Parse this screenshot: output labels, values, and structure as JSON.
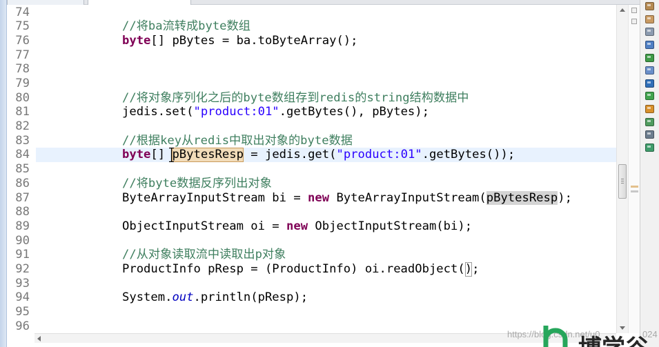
{
  "editor": {
    "lines": [
      {
        "n": "74",
        "tokens": []
      },
      {
        "n": "75",
        "tokens": [
          {
            "t": "//将ba流转成byte数组",
            "fg": "#3F7F5F"
          }
        ]
      },
      {
        "n": "76",
        "tokens": [
          {
            "t": "byte",
            "fg": "#7F0055",
            "b": true
          },
          {
            "t": "[] pBytes = ba.toByteArray();"
          }
        ]
      },
      {
        "n": "77",
        "tokens": []
      },
      {
        "n": "78",
        "tokens": []
      },
      {
        "n": "79",
        "tokens": []
      },
      {
        "n": "80",
        "tokens": [
          {
            "t": "//将对象序列化之后的byte数组存到redis的string结构数据中",
            "fg": "#3F7F5F"
          }
        ]
      },
      {
        "n": "81",
        "tokens": [
          {
            "t": "jedis.set("
          },
          {
            "t": "\"product:01\"",
            "fg": "#2A00FF"
          },
          {
            "t": ".getBytes(), pBytes);"
          }
        ]
      },
      {
        "n": "82",
        "tokens": []
      },
      {
        "n": "83",
        "tokens": [
          {
            "t": "//根据key从redis中取出对象的byte数据",
            "fg": "#3F7F5F"
          }
        ]
      },
      {
        "n": "84",
        "current": true,
        "tokens": [
          {
            "t": "byte",
            "fg": "#7F0055",
            "b": true
          },
          {
            "t": "[] "
          },
          {
            "t": "pBytesResp",
            "bg": "#F2DCB9",
            "bd": "#C99A5B"
          },
          {
            "t": " = jedis.get("
          },
          {
            "t": "\"product:01\"",
            "fg": "#2A00FF"
          },
          {
            "t": ".getBytes());"
          }
        ]
      },
      {
        "n": "85",
        "tokens": []
      },
      {
        "n": "86",
        "tokens": [
          {
            "t": "//将byte数据反序列出对象",
            "fg": "#3F7F5F"
          }
        ]
      },
      {
        "n": "87",
        "tokens": [
          {
            "t": "ByteArrayInputStream bi = "
          },
          {
            "t": "new",
            "fg": "#7F0055",
            "b": true
          },
          {
            "t": " ByteArrayInputStream("
          },
          {
            "t": "pBytesResp",
            "bg": "#D4D4D4"
          },
          {
            "t": ");"
          }
        ]
      },
      {
        "n": "88",
        "tokens": []
      },
      {
        "n": "89",
        "tokens": [
          {
            "t": "ObjectInputStream oi = "
          },
          {
            "t": "new",
            "fg": "#7F0055",
            "b": true
          },
          {
            "t": " ObjectInputStream(bi);"
          }
        ]
      },
      {
        "n": "90",
        "tokens": []
      },
      {
        "n": "91",
        "tokens": [
          {
            "t": "//从对象读取流中读取出p对象",
            "fg": "#3F7F5F"
          }
        ]
      },
      {
        "n": "92",
        "tokens": [
          {
            "t": "ProductInfo pResp = (ProductInfo) oi.readObject("
          },
          {
            "t": ")",
            "bd": "#9B9B9B"
          },
          {
            "t": ";"
          }
        ]
      },
      {
        "n": "93",
        "tokens": []
      },
      {
        "n": "94",
        "tokens": [
          {
            "t": "System."
          },
          {
            "t": "out",
            "fg": "#0000C0",
            "i": true
          },
          {
            "t": ".println(pResp);"
          }
        ]
      },
      {
        "n": "95",
        "tokens": []
      },
      {
        "n": "96",
        "tokens": []
      }
    ]
  },
  "colors": {
    "current_line": "#E8F2FE",
    "line_number": "#787878",
    "default_text": "#000000"
  },
  "side_toolbar": {
    "icons": [
      {
        "name": "package-explorer-icon",
        "color": "#B58A52"
      },
      {
        "name": "navigator-icon",
        "color": "#C99A62"
      },
      {
        "name": "outline-icon",
        "color": "#8C9BB0"
      },
      {
        "name": "type-hierarchy-icon",
        "color": "#4F7FC4"
      },
      {
        "name": "library-icon",
        "color": "#3E9A47"
      },
      {
        "name": "image-icon",
        "color": "#6A8FC9"
      },
      {
        "name": "console-icon",
        "color": "#2F6FB8"
      },
      {
        "name": "servers-icon",
        "color": "#40A34E"
      },
      {
        "name": "wrench-icon",
        "color": "#D8902C"
      },
      {
        "name": "gear-icon",
        "color": "#4F9B5E"
      },
      {
        "name": "bug-icon",
        "color": "#6C7D8E"
      },
      {
        "name": "deploy-icon",
        "color": "#3E9C6B"
      }
    ]
  },
  "watermark": {
    "url_left": "https://blog.csdn.net/u0",
    "url_right": "024"
  },
  "logo": {
    "text": "博学谷",
    "mark_color": "#26A65B"
  }
}
